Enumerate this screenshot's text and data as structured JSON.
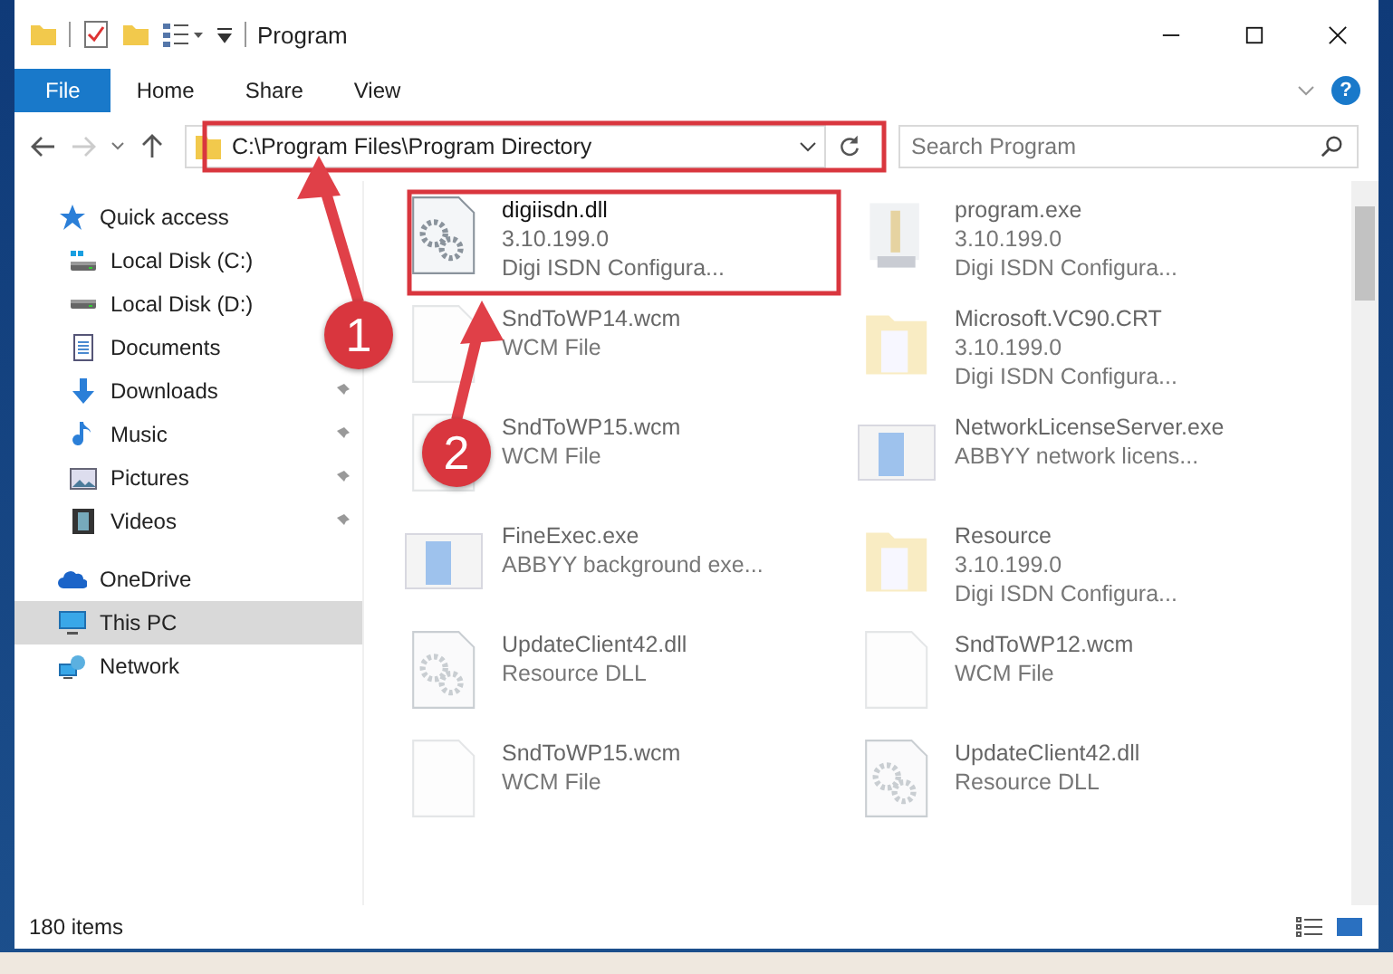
{
  "window": {
    "title": "Program"
  },
  "ribbon": {
    "tabs": [
      {
        "label": "File",
        "selected": true
      },
      {
        "label": "Home",
        "selected": false
      },
      {
        "label": "Share",
        "selected": false
      },
      {
        "label": "View",
        "selected": false
      }
    ],
    "help": "?"
  },
  "address": {
    "path": "C:\\Program Files\\Program Directory"
  },
  "search": {
    "placeholder": "Search Program"
  },
  "sidebar": {
    "items": [
      {
        "label": "Quick access",
        "kind": "star",
        "selected": false,
        "children": [
          {
            "label": "Local Disk (C:)",
            "kind": "disk-c",
            "pinned": false
          },
          {
            "label": "Local Disk (D:)",
            "kind": "disk",
            "pinned": false
          },
          {
            "label": "Documents",
            "kind": "doc",
            "pinned": false
          },
          {
            "label": "Downloads",
            "kind": "download",
            "pinned": true
          },
          {
            "label": "Music",
            "kind": "music",
            "pinned": true
          },
          {
            "label": "Pictures",
            "kind": "pictures",
            "pinned": true
          },
          {
            "label": "Videos",
            "kind": "videos",
            "pinned": true
          }
        ]
      },
      {
        "label": "OneDrive",
        "kind": "cloud",
        "selected": false
      },
      {
        "label": "This PC",
        "kind": "pc",
        "selected": true
      },
      {
        "label": "Network",
        "kind": "network",
        "selected": false
      }
    ]
  },
  "files": [
    {
      "name": "digiisdn.dll",
      "lines": [
        "3.10.199.0",
        "Digi ISDN Configura..."
      ],
      "kind": "dll",
      "faded": false
    },
    {
      "name": "program.exe",
      "lines": [
        "3.10.199.0",
        "Digi ISDN Configura..."
      ],
      "kind": "setup",
      "faded": true
    },
    {
      "name": "SndToWP14.wcm",
      "lines": [
        "WCM File"
      ],
      "kind": "file",
      "faded": true
    },
    {
      "name": "Microsoft.VC90.CRT",
      "lines": [
        "3.10.199.0",
        "Digi ISDN Configura..."
      ],
      "kind": "folder",
      "faded": true
    },
    {
      "name": "SndToWP15.wcm",
      "lines": [
        "WCM File"
      ],
      "kind": "file",
      "faded": true
    },
    {
      "name": "NetworkLicenseServer.exe",
      "lines": [
        "ABBYY network licens..."
      ],
      "kind": "app",
      "faded": true
    },
    {
      "name": "FineExec.exe",
      "lines": [
        "ABBYY background exe..."
      ],
      "kind": "app",
      "faded": true
    },
    {
      "name": "Resource",
      "lines": [
        "3.10.199.0",
        "Digi ISDN Configura..."
      ],
      "kind": "folder",
      "faded": true
    },
    {
      "name": "UpdateClient42.dll",
      "lines": [
        "Resource DLL"
      ],
      "kind": "dll",
      "faded": true
    },
    {
      "name": "SndToWP12.wcm",
      "lines": [
        "WCM File"
      ],
      "kind": "file",
      "faded": true
    },
    {
      "name": "SndToWP15.wcm",
      "lines": [
        "WCM File"
      ],
      "kind": "file",
      "faded": true
    },
    {
      "name": "UpdateClient42.dll",
      "lines": [
        "Resource DLL"
      ],
      "kind": "dll",
      "faded": true
    }
  ],
  "annotations": [
    {
      "number": "1"
    },
    {
      "number": "2"
    }
  ],
  "status_bar": {
    "count": "180 items"
  }
}
